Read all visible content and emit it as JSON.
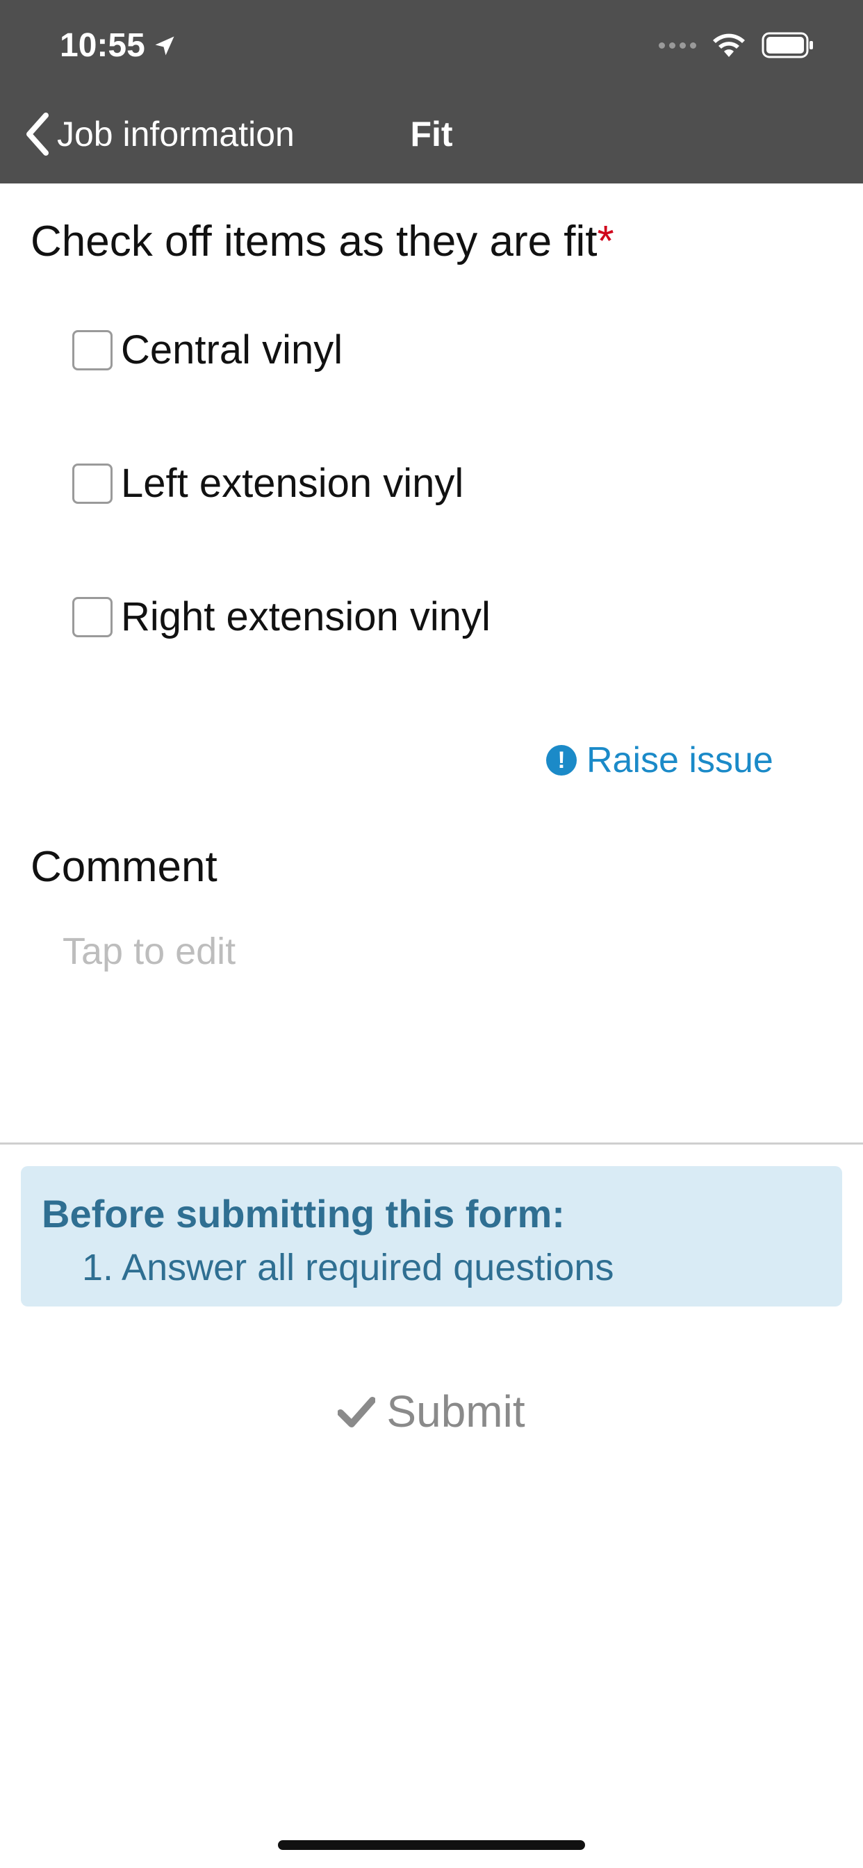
{
  "status_bar": {
    "time": "10:55"
  },
  "nav": {
    "back_label": "Job information",
    "title": "Fit"
  },
  "form": {
    "question": "Check off items as they are fit",
    "required_marker": "*",
    "items": [
      {
        "label": "Central vinyl",
        "checked": false
      },
      {
        "label": "Left extension vinyl",
        "checked": false
      },
      {
        "label": "Right extension vinyl",
        "checked": false
      }
    ],
    "raise_issue_label": "Raise issue",
    "comment_label": "Comment",
    "comment_placeholder": "Tap to edit"
  },
  "notice": {
    "title": "Before submitting this form:",
    "items": [
      "1. Answer all required questions"
    ]
  },
  "submit_label": "Submit",
  "colors": {
    "header_bg": "#4f4f4f",
    "accent": "#1b8ac8",
    "required": "#d0021b",
    "notice_bg": "#d9ebf5",
    "notice_text": "#2f6f92"
  }
}
